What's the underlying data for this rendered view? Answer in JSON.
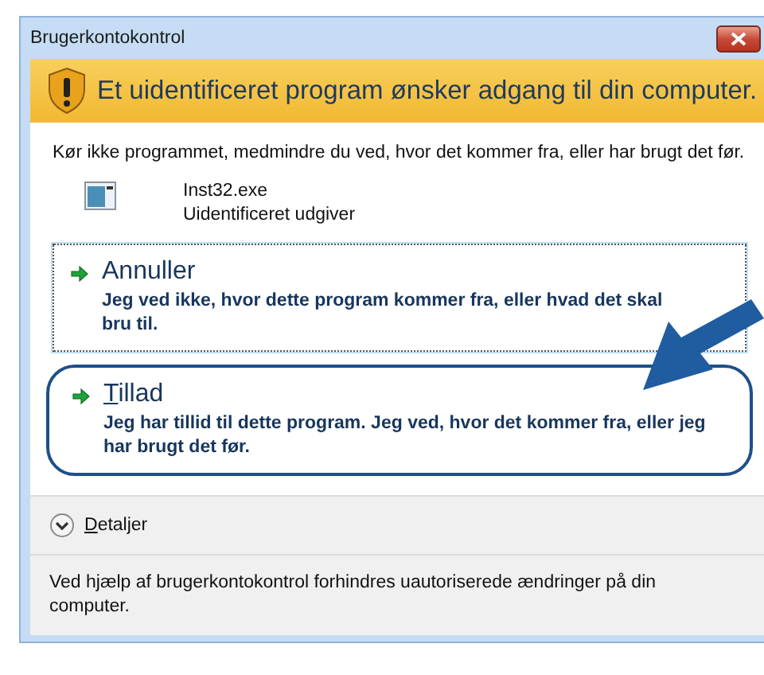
{
  "window": {
    "title": "Brugerkontokontrol"
  },
  "banner": {
    "text": "Et uidentificeret program ønsker adgang til din computer."
  },
  "description": "Kør ikke programmet, medmindre du ved, hvor det kommer fra, eller har brugt det før.",
  "program": {
    "name": "Inst32.exe",
    "publisher": "Uidentificeret udgiver"
  },
  "options": [
    {
      "title": "Annuller",
      "detail": "Jeg ved ikke, hvor dette program kommer fra, eller hvad det skal bru til.",
      "mnemonic": false,
      "focused": true,
      "highlighted": false
    },
    {
      "title": "Tillad",
      "detail": "Jeg har tillid til dette program. Jeg ved, hvor det kommer fra, eller jeg har brugt det før.",
      "mnemonic": true,
      "focused": false,
      "highlighted": true
    }
  ],
  "details": {
    "label": "Detaljer",
    "expanded": false
  },
  "footer": "Ved hjælp af brugerkontokontrol forhindres uautoriserede ændringer på din computer."
}
